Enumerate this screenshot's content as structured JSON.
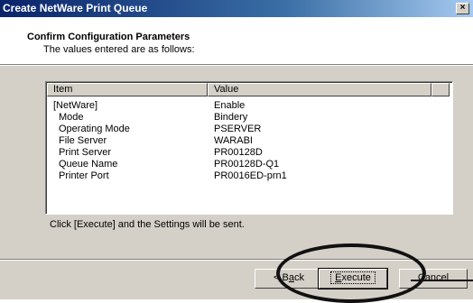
{
  "window": {
    "title": "Create NetWare Print Queue",
    "close_glyph": "×"
  },
  "header": {
    "title": "Confirm Configuration Parameters",
    "subtitle": "The values entered are as follows:"
  },
  "table": {
    "columns": [
      "Item",
      "Value"
    ],
    "rows": [
      {
        "item": "[NetWare]",
        "value": "Enable"
      },
      {
        "item": "Mode",
        "value": "Bindery"
      },
      {
        "item": "Operating Mode",
        "value": "PSERVER"
      },
      {
        "item": "File Server",
        "value": "WARABI"
      },
      {
        "item": "Print Server",
        "value": "PR00128D"
      },
      {
        "item": "Queue Name",
        "value": "PR00128D-Q1"
      },
      {
        "item": "Printer Port",
        "value": "PR0016ED-prn1"
      }
    ]
  },
  "hint": "Click [Execute] and the Settings will be sent.",
  "buttons": {
    "back_prefix": "< B",
    "back_mnemonic": "a",
    "back_suffix": "ck",
    "execute_mnemonic": "E",
    "execute_rest": "xecute",
    "cancel": "Cancel"
  }
}
